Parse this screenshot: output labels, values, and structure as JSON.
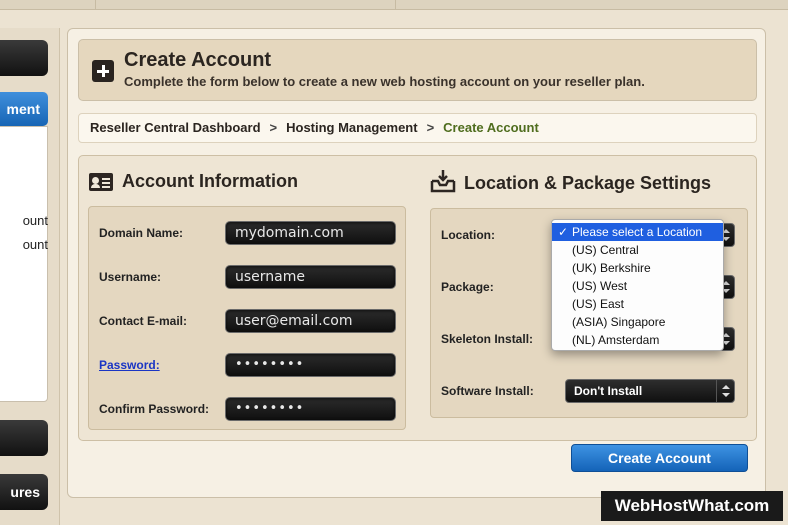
{
  "sidebar": {
    "item_top": "",
    "item_active": "ment",
    "sub_items": [
      "ount",
      "ount"
    ],
    "item_bottom1": "",
    "item_bottom2": "ures"
  },
  "header": {
    "title": "Create Account",
    "subtitle": "Complete the form below to create a new web hosting account on your reseller plan."
  },
  "breadcrumb": {
    "items": [
      "Reseller Central Dashboard",
      "Hosting Management",
      "Create Account"
    ],
    "separator": ">"
  },
  "account_info": {
    "title": "Account Information",
    "fields": {
      "domain": {
        "label": "Domain Name:",
        "value": "mydomain.com"
      },
      "username": {
        "label": "Username:",
        "value": "username"
      },
      "email": {
        "label": "Contact E-mail:",
        "value": "user@email.com"
      },
      "password": {
        "label": "Password:",
        "value": "••••••••"
      },
      "confirm": {
        "label": "Confirm Password:",
        "value": "••••••••"
      }
    }
  },
  "location_settings": {
    "title": "Location & Package Settings",
    "fields": {
      "location": {
        "label": "Location:"
      },
      "package": {
        "label": "Package:"
      },
      "skeleton": {
        "label": "Skeleton Install:"
      },
      "software": {
        "label": "Software Install:",
        "value": "Don't Install"
      }
    },
    "location_options": [
      "Please select a Location",
      "(US) Central",
      "(UK) Berkshire",
      "(US) West",
      "(US) East",
      "(ASIA) Singapore",
      "(NL) Amsterdam"
    ],
    "selected_check": "✓"
  },
  "actions": {
    "create_button": "Create Account"
  },
  "watermark": "WebHostWhat.com",
  "colors": {
    "accent_blue": "#1f5fe0",
    "breadcrumb_current": "#4f6d1e",
    "panel_bg": "#e4d7c0"
  }
}
